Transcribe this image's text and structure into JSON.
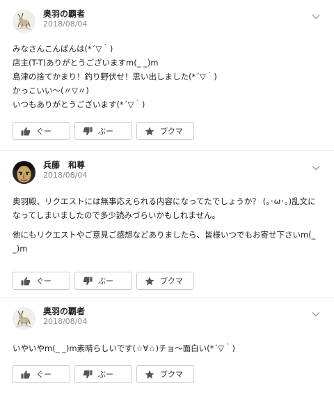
{
  "comments": [
    {
      "user": "奥羽の覇者",
      "date": "2018/08/04",
      "avatar_icon": "deer-figure-avatar",
      "lines": [
        "みなさんこんばんは(*´▽｀)",
        "店主(T-T)ありがとうございますm(_ _)m",
        "島津の捨てかまり！釣り野伏せ！思い出しました(*´▽｀)",
        "かっこいい～(〃▽〃)",
        "いつもありがとうございます(*´▽｀)"
      ]
    },
    {
      "user": "兵藤　和尊",
      "date": "2018/08/04",
      "avatar_icon": "manga-face-avatar",
      "paragraphs": [
        [
          "奥羽殿、リクエストには無事応えられる内容になってたでしょうか？ (｡･ω･｡)乱文に",
          "なってしまいましたので多少読みづらいかもしれません。"
        ],
        [
          "他にもリクエストやご意見ご感想などありましたら、皆様いつでもお寄せ下さいm(_",
          "_)m"
        ]
      ]
    },
    {
      "user": "奥羽の覇者",
      "date": "2018/08/04",
      "avatar_icon": "deer-figure-avatar",
      "lines": [
        "いやいやm(_ _)m素晴らしいです(☆∀☆)チョ～面白い(*´▽｀)"
      ]
    }
  ],
  "actions": {
    "good_label": "ぐー",
    "bad_label": "ぶー",
    "bookmark_label": "ブクマ"
  },
  "icons": {
    "good": "thumbs-up-icon",
    "bad": "thumbs-down-icon",
    "bookmark": "star-icon",
    "menu": "chevron-down-icon"
  },
  "colors": {
    "icon": "#555555",
    "border": "#c9c9c9",
    "date": "#888888",
    "divider": "#e9e9e9"
  }
}
